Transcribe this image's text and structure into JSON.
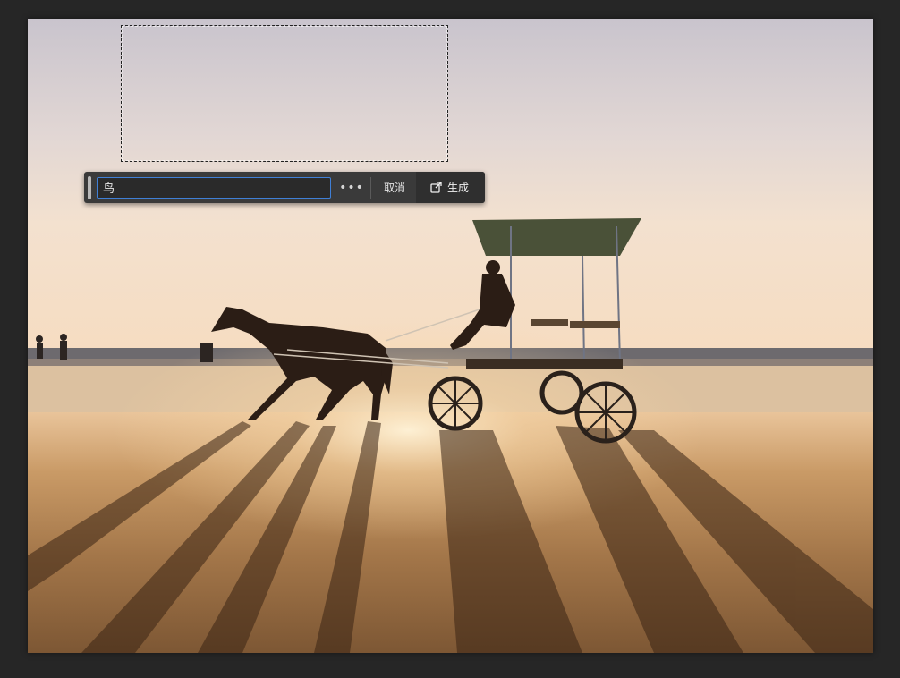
{
  "canvas": {
    "image_description_icon": "photo-beach-horse-carriage"
  },
  "context_bar": {
    "prompt_value": "鸟",
    "more_label": "•••",
    "cancel_label": "取消",
    "generate_label": "生成",
    "generate_icon": "generate-icon"
  },
  "colors": {
    "workspace_bg": "#262626",
    "bar_bg": "#3a3a3a",
    "input_focus": "#3f7fd6"
  }
}
